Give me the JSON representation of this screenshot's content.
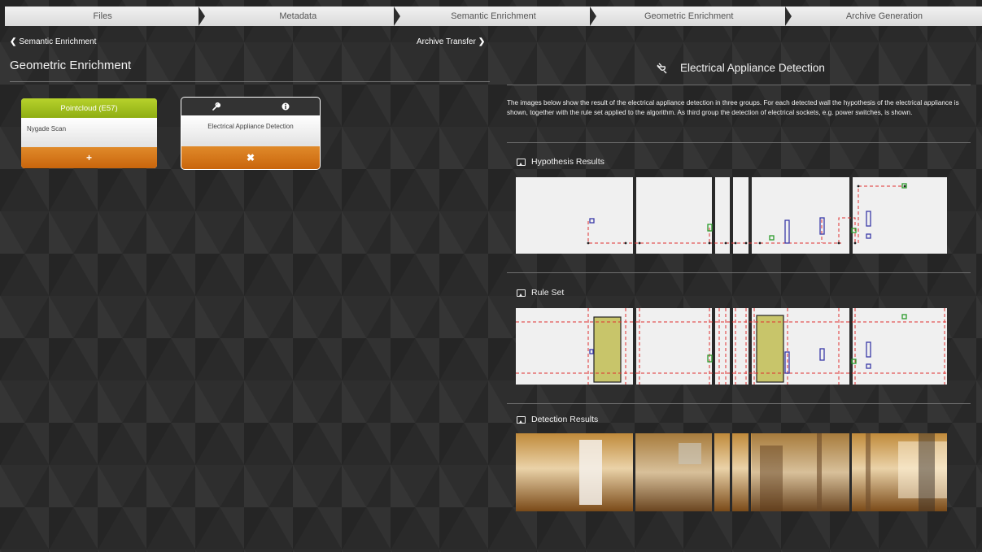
{
  "wizard": {
    "steps": [
      "Files",
      "Metadata",
      "Semantic Enrichment",
      "Geometric Enrichment",
      "Archive Generation"
    ]
  },
  "nav": {
    "back_label": "Semantic Enrichment",
    "forward_label": "Archive Transfer"
  },
  "left": {
    "title": "Geometric Enrichment"
  },
  "cards": [
    {
      "header": "Pointcloud (E57)",
      "body": "Nygade Scan",
      "button": "+"
    },
    {
      "body": "Electrical Appliance Detection",
      "button": "✖",
      "icons": [
        "wrench-icon",
        "info-icon"
      ]
    }
  ],
  "right": {
    "title": "Electrical Appliance Detection",
    "description": "The images below show the result of the electrical appliance detection in three groups. For each detected wall the hypothesis of the electrical appliance is shown, together with the rule set applied to the algorithm. As third group the detection of electrical sockets, e.g. power switches, is shown.",
    "sections": [
      "Hypothesis Results",
      "Rule Set",
      "Detection Results"
    ]
  },
  "colors": {
    "accent_green": "#9cbd1c",
    "accent_orange": "#d9761a",
    "marker_blue": "#3a3aa8",
    "marker_green": "#2c9c2c",
    "rule_red": "#e03030"
  }
}
